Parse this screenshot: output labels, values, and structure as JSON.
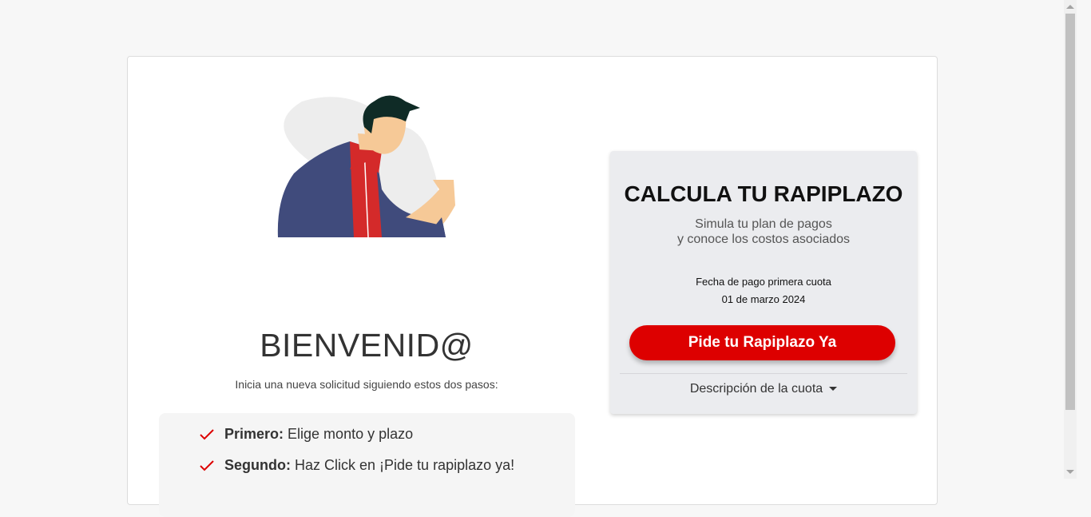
{
  "welcome": {
    "title": "BIENVENID@",
    "subtitle": "Inicia una nueva solicitud siguiendo estos dos pasos:",
    "steps": [
      {
        "label": "Primero:",
        "text": "Elige monto y plazo"
      },
      {
        "label": "Segundo:",
        "text": "Haz Click en ¡Pide tu rapiplazo ya!"
      }
    ]
  },
  "calculator": {
    "title": "CALCULA TU RAPIPLAZO",
    "subtitle_line1": "Simula tu plan de pagos",
    "subtitle_line2": "y conoce los costos asociados",
    "first_payment_label": "Fecha de pago primera cuota",
    "first_payment_date": "01 de marzo 2024",
    "cta_label": "Pide tu Rapiplazo Ya",
    "description_toggle": "Descripción de la cuota"
  },
  "icons": {
    "step_check": "check-icon",
    "toggle_caret": "caret-down-icon",
    "illustration": "person-illustration"
  },
  "colors": {
    "accent": "#dd0000",
    "panel_bg": "#ebecef",
    "page_bg": "#f7f7f7"
  }
}
